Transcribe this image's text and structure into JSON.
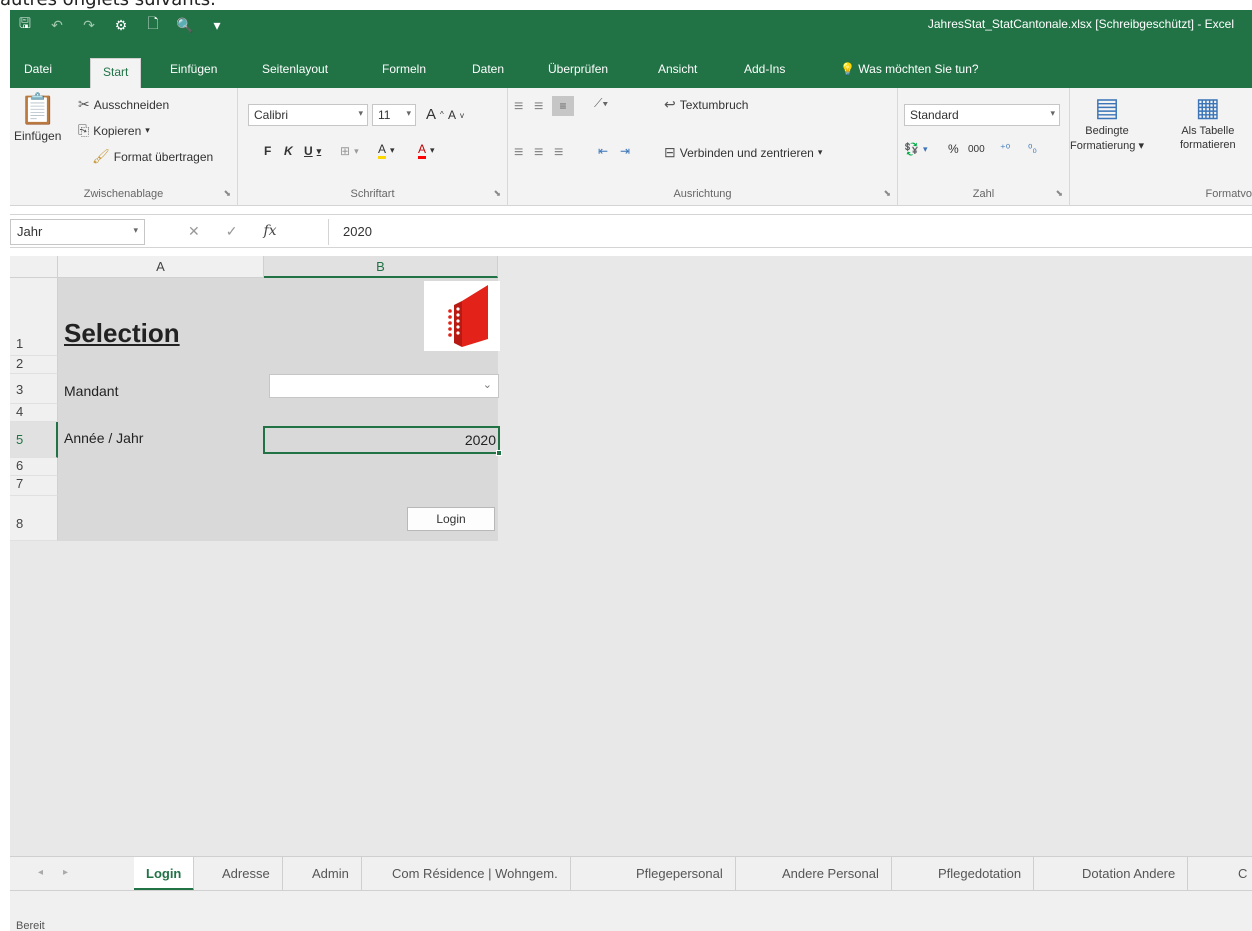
{
  "caption": "autres onglets suivants.",
  "window": {
    "title": "JahresStat_StatCantonale.xlsx [Schreibgeschützt] - Excel",
    "qat": {
      "save": "🖫",
      "undo": "↶",
      "redo": "↷",
      "extra1": "⚙",
      "new": "🗋",
      "preview": "🔍",
      "more": "▾"
    }
  },
  "ribbon_tabs": [
    "Datei",
    "Start",
    "Einfügen",
    "Seitenlayout",
    "Formeln",
    "Daten",
    "Überprüfen",
    "Ansicht",
    "Add-Ins"
  ],
  "tell_me": "Was möchten Sie tun?",
  "clipboard": {
    "paste_label": "Einfügen",
    "cut": "Ausschneiden",
    "copy": "Kopieren",
    "format_painter": "Format übertragen",
    "group": "Zwischenablage"
  },
  "font": {
    "name": "Calibri",
    "size": "11",
    "bold": "F",
    "italic": "K",
    "underline": "U",
    "grow": "A",
    "shrink": "A",
    "fill_glyph": "A",
    "color_glyph": "A",
    "group": "Schriftart"
  },
  "alignment": {
    "wrap": "Textumbruch",
    "merge": "Verbinden und zentrieren",
    "group": "Ausrichtung"
  },
  "number": {
    "format": "Standard",
    "percent": "%",
    "thousands": "000",
    "inc_dec": "⁺⁰",
    "dec_dec": "⁰₀",
    "group": "Zahl"
  },
  "styles": {
    "conditional": [
      "Bedingte",
      "Formatierung ▾"
    ],
    "as_table": [
      "Als Tabelle",
      "formatieren"
    ],
    "group": "Formatvo"
  },
  "formula_bar": {
    "name_box": "Jahr",
    "cancel": "✕",
    "enter": "✓",
    "fx": "fx",
    "value": "2020"
  },
  "grid": {
    "columns": [
      "A",
      "B"
    ],
    "rows": [
      "1",
      "2",
      "3",
      "4",
      "5",
      "6",
      "7",
      "8"
    ],
    "title": "Selection",
    "mandant_label": "Mandant",
    "year_label": "Année / Jahr",
    "year_value": "2020",
    "login_button": "Login"
  },
  "sheet_tabs": [
    "Login",
    "Adresse",
    "Admin",
    "Com Résidence | Wohngem.",
    "Pflegepersonal",
    "Andere Personal",
    "Pflegedotation",
    "Dotation Andere",
    "C"
  ],
  "active_sheet": "Login",
  "status": "Bereit",
  "colors": {
    "excel_green": "#217346",
    "logo_red": "#e32219",
    "sheet_gray": "#d9d9d9"
  }
}
